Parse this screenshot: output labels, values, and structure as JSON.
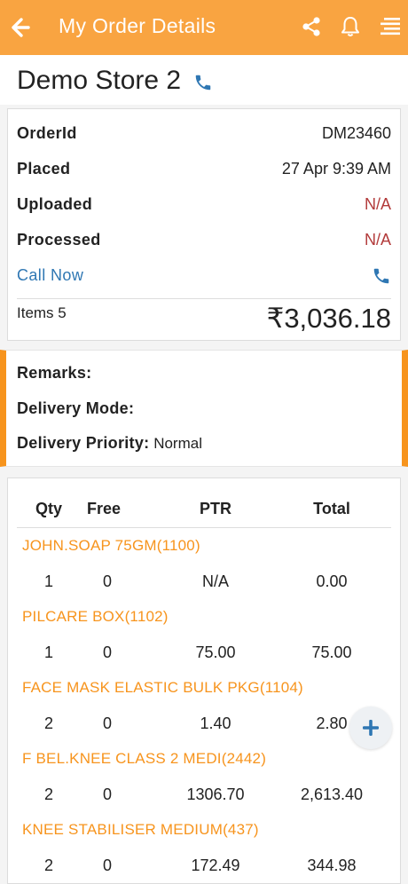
{
  "header": {
    "title": "My Order Details",
    "bg_color": "#f9a441",
    "icons": [
      "arrow-left-icon",
      "share-icon",
      "bell-icon",
      "menu-icon"
    ]
  },
  "store": {
    "name": "Demo Store 2",
    "icon": "phone-icon"
  },
  "order": {
    "order_id_label": "OrderId",
    "order_id": "DM23460",
    "placed_label": "Placed",
    "placed": "27 Apr 9:39 AM",
    "uploaded_label": "Uploaded",
    "uploaded": "N/A",
    "processed_label": "Processed",
    "processed": "N/A",
    "call_now": "Call Now",
    "items_label": "Items 5",
    "amount": "₹3,036.18"
  },
  "delivery": {
    "remarks_label": "Remarks:",
    "remarks": "",
    "mode_label": "Delivery Mode:",
    "mode": "",
    "priority_label": "Delivery Priority:",
    "priority": " Normal"
  },
  "table": {
    "headers": {
      "qty": "Qty",
      "free": "Free",
      "ptr": "PTR",
      "total": "Total"
    },
    "rows": [
      {
        "name": "JOHN.SOAP 75GM(1100)",
        "qty": "1",
        "free": "0",
        "ptr": "N/A",
        "total": "0.00"
      },
      {
        "name": "PILCARE BOX(1102)",
        "qty": "1",
        "free": "0",
        "ptr": "75.00",
        "total": "75.00"
      },
      {
        "name": "FACE MASK ELASTIC BULK PKG(1104)",
        "qty": "2",
        "free": "0",
        "ptr": "1.40",
        "total": "2.80"
      },
      {
        "name": "F BEL.KNEE CLASS 2 MEDI(2442)",
        "qty": "2",
        "free": "0",
        "ptr": "1306.70",
        "total": "2,613.40"
      },
      {
        "name": "KNEE STABILISER MEDIUM(437)",
        "qty": "2",
        "free": "0",
        "ptr": "172.49",
        "total": "344.98"
      }
    ]
  },
  "fab": {
    "icon": "plus-icon"
  },
  "colors": {
    "accent": "#f7941d",
    "link": "#2f77b3",
    "na": "#b23a3a"
  }
}
